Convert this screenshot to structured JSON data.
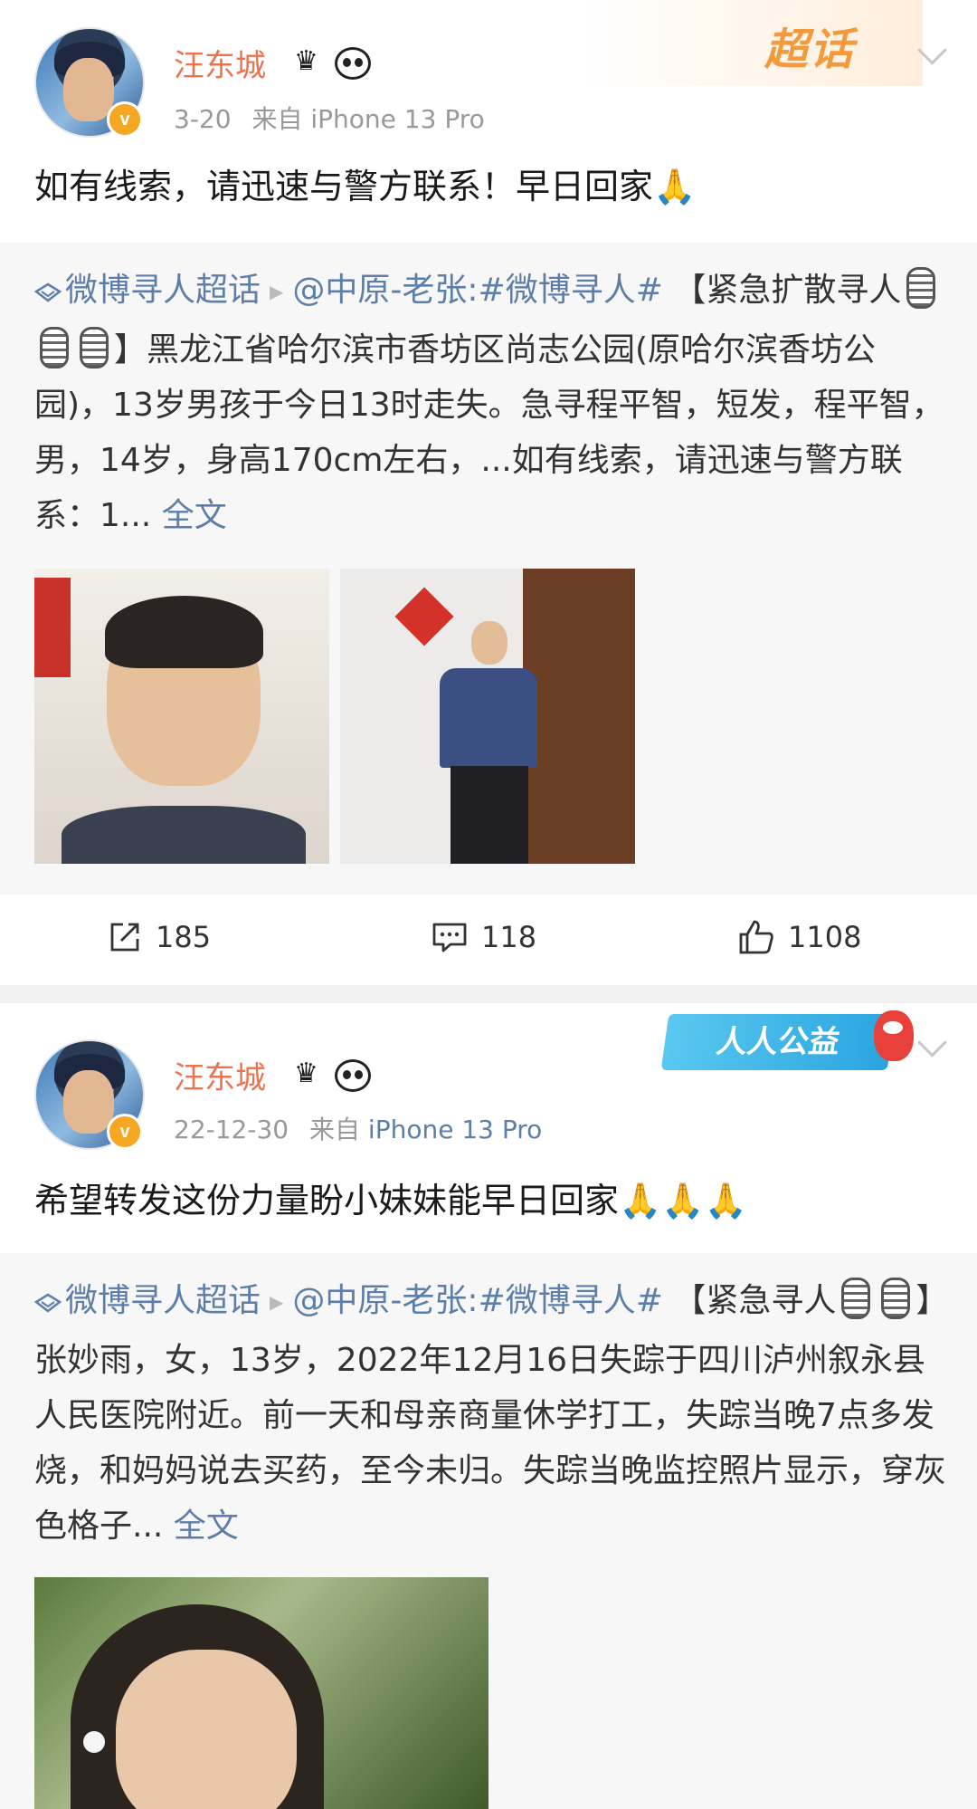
{
  "post1": {
    "username": "汪东城",
    "time": "3-20",
    "source_prefix": "来自",
    "device": "iPhone 13 Pro",
    "chaohua_badge": "超话",
    "text": "如有线索，请迅速与警方联系！早日回家🙏",
    "repost": {
      "topic": "微博寻人超话",
      "author": "@中原-老张:",
      "hashtag": "#微博寻人#",
      "body_a": "【紧急扩散寻人",
      "body_b": "】黑龙江省哈尔滨市香坊区尚志公园(原哈尔滨香坊公园)，13岁男孩于今日13时走失。急寻程平智，短发，程平智，男，14岁，身高170cm左右，...如有线索，请迅速与警方联系：1...",
      "full_text_link": "全文"
    },
    "actions": {
      "repost_count": "185",
      "comment_count": "118",
      "like_count": "1108"
    }
  },
  "post2": {
    "username": "汪东城",
    "time": "22-12-30",
    "source_prefix": "来自",
    "device": "iPhone 13 Pro",
    "badge": "人人公益",
    "text": "希望转发这份力量盼小妹妹能早日回家🙏🙏🙏",
    "repost": {
      "topic": "微博寻人超话",
      "author": "@中原-老张:",
      "hashtag": "#微博寻人#",
      "body_a": "【紧急寻人",
      "body_b": "】张妙雨，女，13岁，2022年12月16日失踪于四川泸州叙永县人民医院附近。前一天和母亲商量休学打工，失踪当晚7点多发烧，和妈妈说去买药，至今未归。失踪当晚监控照片显示，穿灰色格子...",
      "full_text_link": "全文"
    }
  },
  "colors": {
    "username": "#eb7350",
    "link": "#5d7ea8",
    "verified": "#f5a623"
  }
}
